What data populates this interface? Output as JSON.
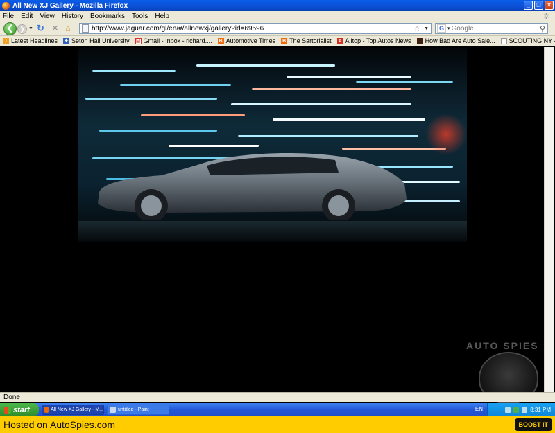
{
  "window": {
    "title": "All New XJ Gallery - Mozilla Firefox",
    "buttons": [
      "_",
      "□",
      "×"
    ]
  },
  "menu": [
    "File",
    "Edit",
    "View",
    "History",
    "Bookmarks",
    "Tools",
    "Help"
  ],
  "nav": {
    "url": "http://www.jaguar.com/gl/en/#/allnewxj/gallery?id=69596",
    "search_placeholder": "Google",
    "search_engine": "G"
  },
  "bookmarks": [
    {
      "label": "Latest Headlines",
      "icon": "rss-icon",
      "color": "#f0a020"
    },
    {
      "label": "Seton Hall University",
      "icon": "university-icon",
      "color": "#3060c0"
    },
    {
      "label": "Gmail - Inbox - richard....",
      "icon": "gmail-icon",
      "color": "#d83020"
    },
    {
      "label": "Automotive Times",
      "icon": "blogger-icon",
      "color": "#f06a10"
    },
    {
      "label": "The Sartorialist",
      "icon": "blogger-icon",
      "color": "#f06a10"
    },
    {
      "label": "Alltop - Top Autos News",
      "icon": "alltop-icon",
      "color": "#d83020"
    },
    {
      "label": "How Bad Are Auto Sale...",
      "icon": "page-icon",
      "color": "#402010"
    },
    {
      "label": "SCOUTING NY - www.s...",
      "icon": "page-icon",
      "color": "#a0a0a0"
    }
  ],
  "status": "Done",
  "watermark": "AUTO SPIES",
  "taskbar": {
    "start": "start",
    "tasks": [
      {
        "label": "All New XJ Gallery - M...",
        "active": true
      },
      {
        "label": "untitled - Paint",
        "active": false
      }
    ],
    "lang": "EN",
    "time": "8:31 PM"
  },
  "footer": {
    "text": "Hosted on AutoSpies.com",
    "button": "BOOST IT"
  }
}
